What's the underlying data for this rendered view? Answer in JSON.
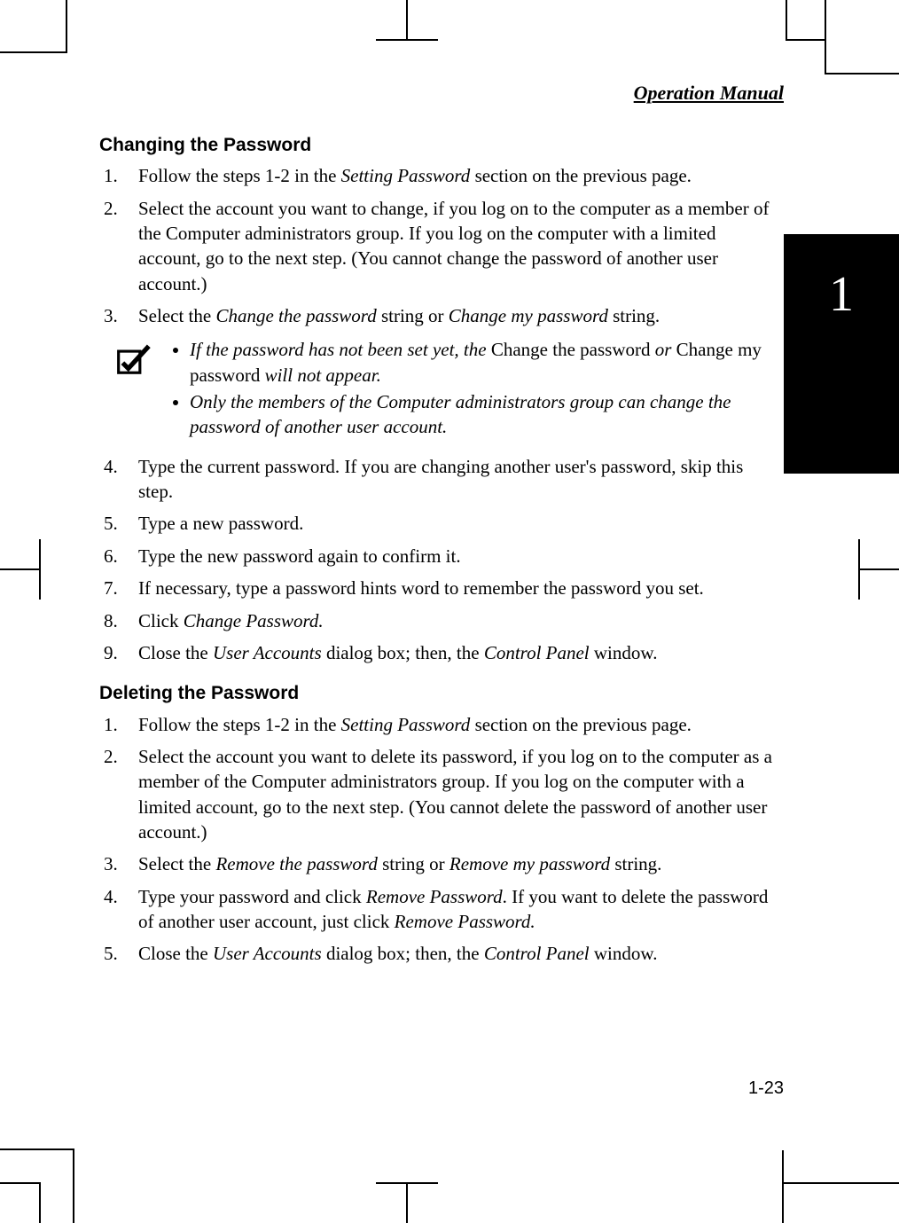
{
  "header": {
    "title": "Operation Manual"
  },
  "side_tab": "1",
  "page_number": "1-23",
  "sec1": {
    "title": "Changing the Password",
    "steps": {
      "s1": {
        "a": "Follow the steps 1-2 in the ",
        "b": "Setting Password",
        "c": " section on the previous page."
      },
      "s2": "Select the account you want to change, if you log on to the computer as a member of the Computer administrators group.  If you log on the computer with a limited account, go to the next step. (You cannot change the password of another user account.)",
      "s3": {
        "a": "Select the ",
        "b": "Change the password",
        "c": " string or ",
        "d": "Change my password",
        "e": " string."
      },
      "s4": "Type the current password. If you are changing another user's password, skip this step.",
      "s5": "Type a new password.",
      "s6": "Type the new password again to confirm it.",
      "s7": "If necessary, type a password hints word to remember the password you set.",
      "s8": {
        "a": "Click ",
        "b": "Change Password."
      },
      "s9": {
        "a": "Close the ",
        "b": "User Accounts",
        "c": " dialog box; then, the ",
        "d": "Control Panel",
        "e": " window."
      }
    },
    "note": {
      "n1": {
        "a": "If the password has not been set yet, the ",
        "b": "Change the password",
        "c": " or ",
        "d": "Change my password",
        "e": " will not appear."
      },
      "n2": "Only the members of the Computer administrators group can change the password of another user account."
    }
  },
  "sec2": {
    "title": "Deleting the Password",
    "steps": {
      "s1": {
        "a": "Follow the steps 1-2 in the ",
        "b": "Setting Password",
        "c": " section on the previous page."
      },
      "s2": "Select the account you want to delete its password, if you log on to the computer as a member of the Computer administrators group.  If you log on the computer with a limited account, go to the next step. (You cannot delete the password of another user account.)",
      "s3": {
        "a": "Select the ",
        "b": "Remove the password",
        "c": " string or ",
        "d": "Remove my password",
        "e": " string."
      },
      "s4": {
        "a": "Type your password and click ",
        "b": "Remove Password",
        "c": ". If you want to delete the password of another user account, just click ",
        "d": "Remove Password."
      },
      "s5": {
        "a": "Close the ",
        "b": "User Accounts",
        "c": " dialog box; then, the ",
        "d": "Control Panel",
        "e": " window."
      }
    }
  }
}
